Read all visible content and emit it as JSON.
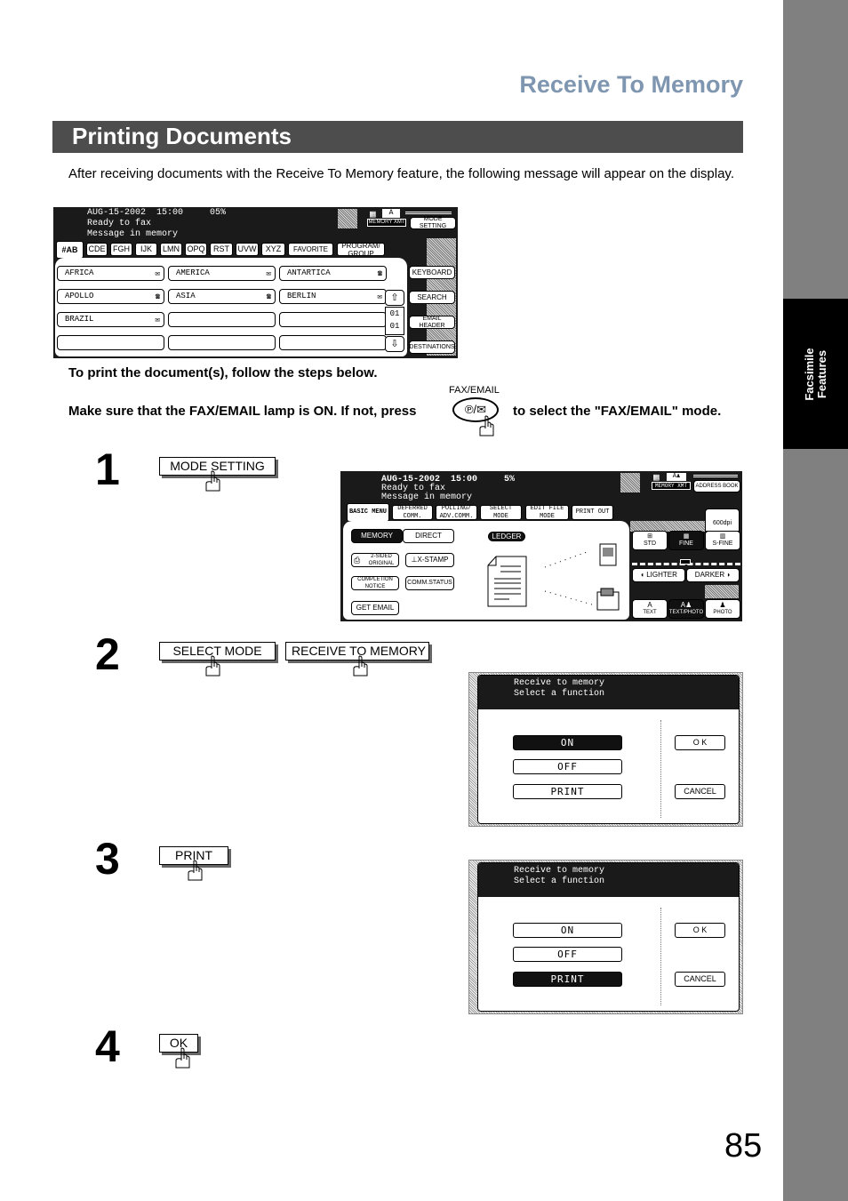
{
  "sidebar": {
    "tab_label_line1": "Facsimile",
    "tab_label_line2": "Features"
  },
  "section_title": "Receive To Memory",
  "banner_title": "Printing Documents",
  "intro_text": "After receiving documents with the Receive To Memory feature, the following message will appear on the display.",
  "instruction_1": "To print the document(s), follow the steps below.",
  "instruction_2_pre": "Make sure that the FAX/EMAIL lamp is ON.  If not, press",
  "instruction_2_post": "to select the \"FAX/EMAIL\" mode.",
  "fax_email_key_label": "FAX/EMAIL",
  "screen1": {
    "status_line1": "AUG-15-2002  15:00     05%",
    "status_line2": "Ready to fax",
    "status_line3": "Message in memory",
    "memory_xmt": "MEMORY XMT",
    "mode_setting": "MODE SETTING",
    "tabs": [
      "#AB",
      "CDE",
      "FGH",
      "IJK",
      "LMN",
      "OPQ",
      "RST",
      "UVW",
      "XYZ",
      "FAVORITE",
      "PROGRAM/ GROUP"
    ],
    "destinations": [
      {
        "name": "AFRICA",
        "icon": "envelope-icon"
      },
      {
        "name": "AMERICA",
        "icon": "envelope-icon"
      },
      {
        "name": "ANTARTICA",
        "icon": "phone-icon"
      },
      {
        "name": "APOLLO",
        "icon": "phone-icon"
      },
      {
        "name": "ASIA",
        "icon": "phone-icon"
      },
      {
        "name": "BERLIN",
        "icon": "envelope-icon"
      },
      {
        "name": "BRAZIL",
        "icon": "envelope-icon"
      },
      {
        "name": "",
        "icon": ""
      },
      {
        "name": "",
        "icon": ""
      },
      {
        "name": "",
        "icon": ""
      },
      {
        "name": "",
        "icon": ""
      },
      {
        "name": "",
        "icon": ""
      }
    ],
    "page_current": "01",
    "page_total": "01",
    "side_buttons": [
      "KEYBOARD",
      "SEARCH",
      "EMAIL HEADER",
      "DESTINATIONS"
    ]
  },
  "steps": [
    {
      "number": "1",
      "buttons": [
        "MODE SETTING"
      ]
    },
    {
      "number": "2",
      "buttons": [
        "SELECT MODE",
        "RECEIVE TO MEMORY"
      ]
    },
    {
      "number": "3",
      "buttons": [
        "PRINT"
      ]
    },
    {
      "number": "4",
      "buttons": [
        "OK"
      ]
    }
  ],
  "screen2": {
    "status_line1": "AUG-15-2002  15:00     5%",
    "status_line2": "Ready to fax",
    "status_line3": "Message in memory",
    "memory_xmt": "MEMORY XMT",
    "address_book": "ADDRESS BOOK",
    "tabs": [
      "BASIC MENU",
      "DEFERRED COMM.",
      "POLLING/ ADV.COMM.",
      "SELECT MODE",
      "EDIT FILE MODE",
      "PRINT OUT"
    ],
    "memory": "MEMORY",
    "direct": "DIRECT",
    "ledger": "LEDGER",
    "two_sided": "2-SIDED ORIGINAL",
    "x_stamp": "X-STAMP",
    "completion_notice": "COMPLETION NOTICE",
    "comm_status": "COMM.STATUS",
    "get_email": "GET EMAIL",
    "resolution_600": "600dpi",
    "resolutions": [
      "STD",
      "FINE",
      "S-FINE"
    ],
    "selected_resolution": "FINE",
    "lighter": "LIGHTER",
    "darker": "DARKER",
    "contrast_level": "4 of 7",
    "modes": [
      "TEXT",
      "TEXT/PHOTO",
      "PHOTO"
    ],
    "selected_mode": "TEXT/PHOTO"
  },
  "dialog1": {
    "line1": "Receive to memory",
    "line2": "Select a function",
    "options": [
      "ON",
      "OFF",
      "PRINT"
    ],
    "selected": "ON",
    "ok": "O K",
    "cancel": "CANCEL"
  },
  "dialog2": {
    "line1": "Receive to memory",
    "line2": "Select a function",
    "options": [
      "ON",
      "OFF",
      "PRINT"
    ],
    "selected": "PRINT",
    "ok": "O K",
    "cancel": "CANCEL"
  },
  "page_number": "85"
}
